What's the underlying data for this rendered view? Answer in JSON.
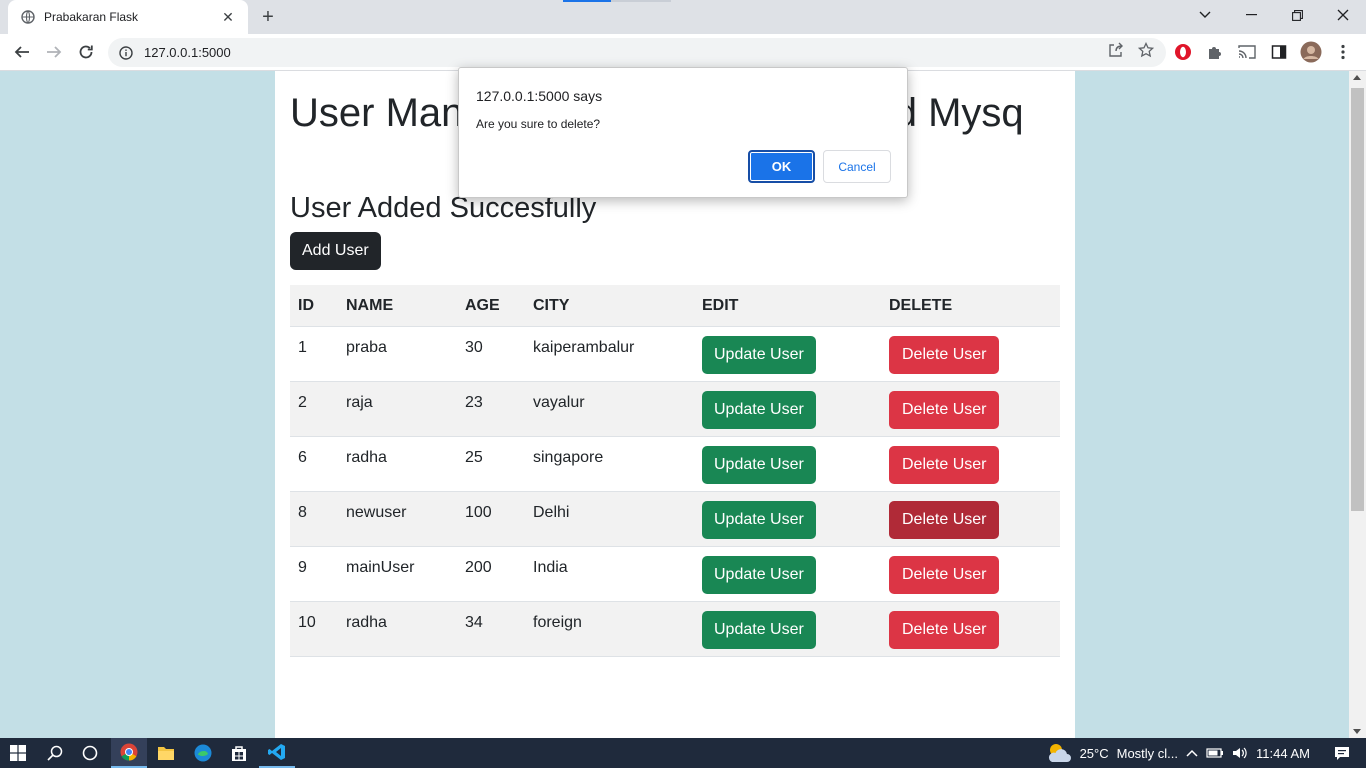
{
  "browser": {
    "tab_title": "Prabakaran Flask",
    "url": "127.0.0.1:5000"
  },
  "page": {
    "heading": "User Management Using Flask and Mysq",
    "subheading": "User Added Succesfully",
    "add_user_label": "Add User",
    "table": {
      "headers": [
        "ID",
        "NAME",
        "AGE",
        "CITY",
        "EDIT",
        "DELETE"
      ],
      "rows": [
        {
          "id": "1",
          "name": "praba",
          "age": "30",
          "city": "kaiperambalur"
        },
        {
          "id": "2",
          "name": "raja",
          "age": "23",
          "city": "vayalur"
        },
        {
          "id": "6",
          "name": "radha",
          "age": "25",
          "city": "singapore"
        },
        {
          "id": "8",
          "name": "newuser",
          "age": "100",
          "city": "Delhi"
        },
        {
          "id": "9",
          "name": "mainUser",
          "age": "200",
          "city": "India"
        },
        {
          "id": "10",
          "name": "radha",
          "age": "34",
          "city": "foreign"
        }
      ],
      "update_label": "Update User",
      "delete_label": "Delete User"
    }
  },
  "dialog": {
    "title": "127.0.0.1:5000 says",
    "message": "Are you sure to delete?",
    "ok_label": "OK",
    "cancel_label": "Cancel"
  },
  "taskbar": {
    "weather_temp": "25°C",
    "weather_text": "Mostly cl...",
    "time": "11:44 AM"
  },
  "colors": {
    "page_bg": "#c3dfe6",
    "update_green": "#198754",
    "delete_red": "#dc3545",
    "dialog_ok": "#1a73e8"
  }
}
